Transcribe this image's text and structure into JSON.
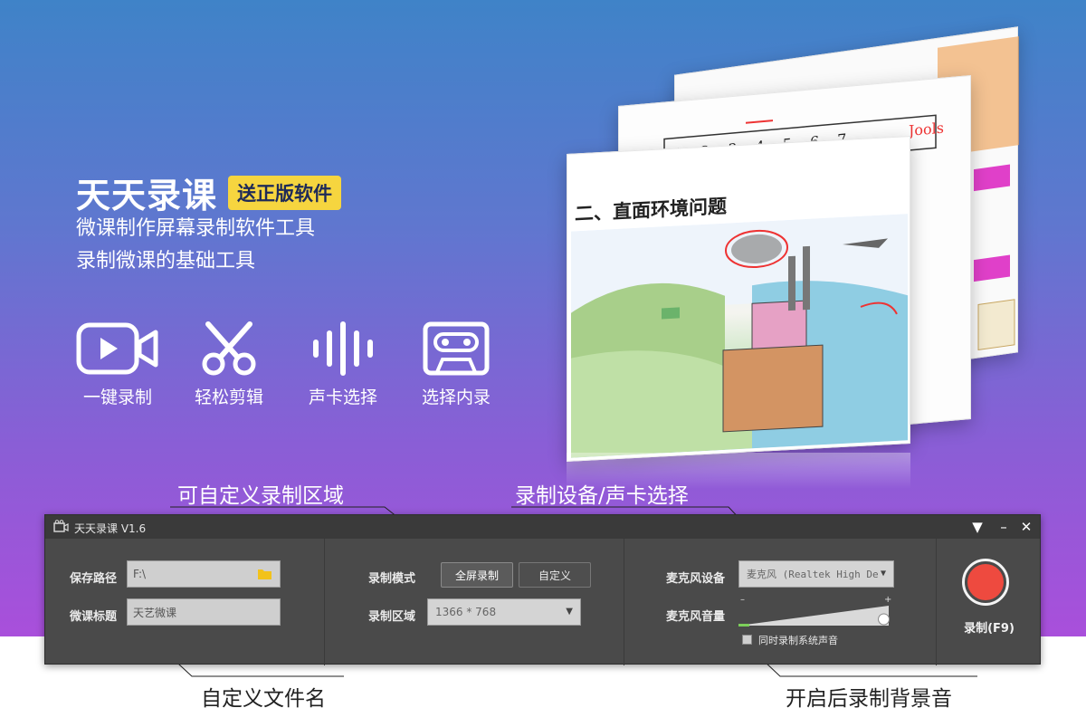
{
  "promo": {
    "title": "天天录课",
    "badge": "送正版软件",
    "subtitle1": "微课制作屏幕录制软件工具",
    "subtitle2": "录制微课的基础工具",
    "features": [
      {
        "icon": "video-camera-icon",
        "label": "一键录制"
      },
      {
        "icon": "scissors-icon",
        "label": "轻松剪辑"
      },
      {
        "icon": "audio-wave-icon",
        "label": "声卡选择"
      },
      {
        "icon": "cassette-icon",
        "label": "选择内录"
      }
    ]
  },
  "slides": {
    "front_heading": "二、直面环境问题",
    "numbers": [
      "1",
      "2",
      "3",
      "4",
      "5",
      "6",
      "7"
    ]
  },
  "callouts": {
    "region": "可自定义录制区域",
    "device": "录制设备/声卡选择",
    "filename": "自定义文件名",
    "background_audio": "开启后录制背景音"
  },
  "app": {
    "title": "天天录课 V1.6",
    "window_buttons": {
      "menu": "▼",
      "minimize": "–",
      "close": "✕"
    },
    "save_path_label": "保存路径",
    "save_path_value": "F:\\",
    "course_title_label": "微课标题",
    "course_title_value": "天艺微课",
    "record_mode_label": "录制模式",
    "mode_fullscreen": "全屏录制",
    "mode_custom": "自定义",
    "record_area_label": "录制区域",
    "record_area_value": "1366 * 768",
    "mic_device_label": "麦克风设备",
    "mic_device_value": "麦克风 (Realtek High De",
    "mic_volume_label": "麦克风音量",
    "mic_volume_level": 0.92,
    "volume_min": "–",
    "volume_max": "+",
    "system_audio_label": "同时录制系统声音",
    "system_audio_checked": false,
    "record_button_label": "录制(F9)"
  },
  "colors": {
    "badge": "#f6d53f",
    "record": "#ee4a3f",
    "volume_fill": "#7ccf5a"
  }
}
